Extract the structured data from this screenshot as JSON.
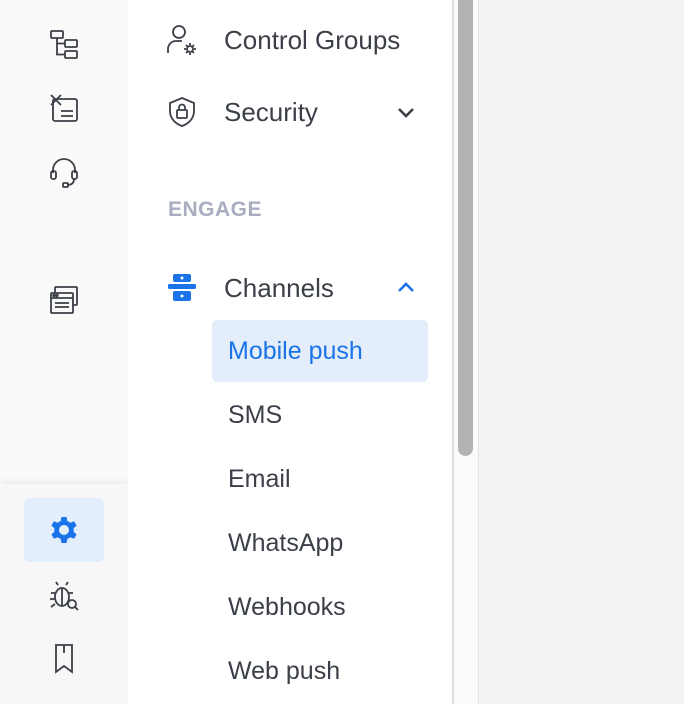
{
  "rail": {
    "top_icons": [
      {
        "name": "workflow-icon"
      },
      {
        "name": "checklist-icon"
      },
      {
        "name": "headset-icon"
      },
      {
        "name": "browser-windows-icon"
      }
    ],
    "bottom_icons": [
      {
        "name": "gear-icon",
        "active": true
      },
      {
        "name": "bug-search-icon"
      },
      {
        "name": "bookmark-icon"
      }
    ]
  },
  "panel": {
    "items": [
      {
        "label": "Control Groups",
        "icon": "user-gear-icon"
      },
      {
        "label": "Security",
        "icon": "shield-lock-icon",
        "expanded": false
      }
    ],
    "section_heading": "ENGAGE",
    "channels": {
      "label": "Channels",
      "icon": "channels-icon",
      "expanded": true,
      "sub_items": [
        "Mobile push",
        "SMS",
        "Email",
        "WhatsApp",
        "Webhooks",
        "Web push"
      ],
      "selected": "Mobile push"
    }
  },
  "colors": {
    "accent": "#1a73e8",
    "selected_bg": "#e4eefb",
    "text": "#3b3f47",
    "section_heading": "#a9adc0",
    "icon": "#3b3f47"
  }
}
